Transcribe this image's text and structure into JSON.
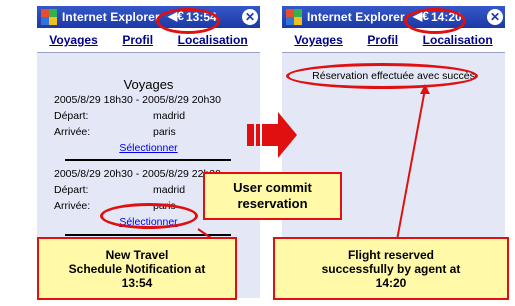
{
  "left_screen": {
    "app_title": "Internet Explorer",
    "clock": "13:54",
    "menu": [
      "Voyages",
      "Profil",
      "Localisation"
    ],
    "section_title": "Voyages",
    "trips": [
      {
        "time": "2005/8/29 18h30 - 2005/8/29 20h30",
        "depart_label": "Départ:",
        "depart_value": "madrid",
        "arrive_label": "Arrivée:",
        "arrive_value": "paris",
        "select_label": "Sélectionner"
      },
      {
        "time": "2005/8/29 20h30 - 2005/8/29 22h30",
        "depart_label": "Départ:",
        "depart_value": "madrid",
        "arrive_label": "Arrivée:",
        "arrive_value": "paris",
        "select_label": "Sélectionner"
      }
    ]
  },
  "right_screen": {
    "app_title": "Internet Explorer",
    "clock": "14:20",
    "menu": [
      "Voyages",
      "Profil",
      "Localisation"
    ],
    "message": "Réservation effectuée avec succès"
  },
  "annotations": {
    "user_commit": "User commit\nreservation",
    "new_travel": "New Travel\nSchedule Notification at\n13:54",
    "flight_reserved": "Flight reserved\nsuccessfully by agent at\n14:20"
  },
  "colors": {
    "highlight": "#e01010",
    "callout_fill": "#fff9a8",
    "titlebar": "#1c3aa6"
  },
  "icons": {
    "speaker": "speaker-icon",
    "close": "close-icon",
    "arrow": "right-arrow-icon",
    "windows": "windows-logo-icon"
  }
}
